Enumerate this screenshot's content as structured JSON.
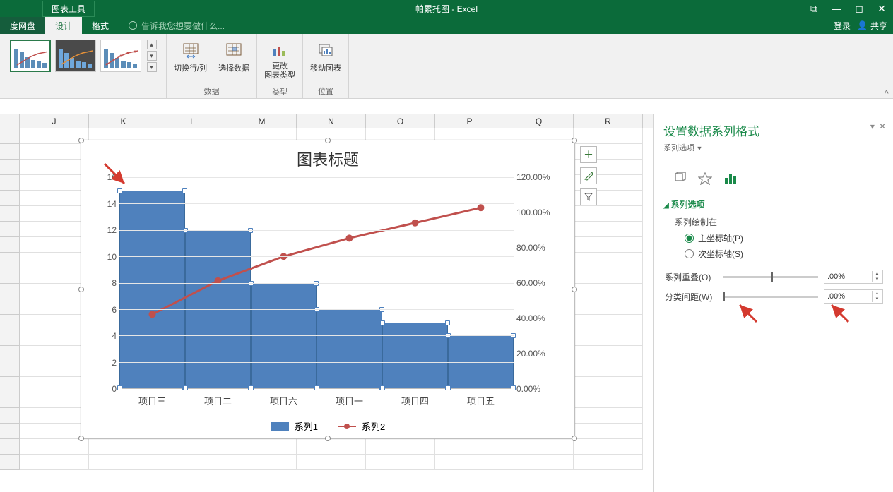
{
  "titlebar": {
    "tools_label": "图表工具",
    "doc_title": "帕累托图 - Excel"
  },
  "tabs": {
    "left": "度网盘",
    "design": "设计",
    "format": "格式",
    "tellme": "告诉我您想要做什么...",
    "login": "登录",
    "share": "共享"
  },
  "ribbon": {
    "data_group": "数据",
    "switch_rowcol": "切换行/列",
    "select_data": "选择数据",
    "type_group": "类型",
    "change_type": "更改\n图表类型",
    "location_group": "位置",
    "move_chart": "移动图表"
  },
  "columns": [
    "J",
    "K",
    "L",
    "M",
    "N",
    "O",
    "P",
    "Q",
    "R"
  ],
  "chart_data": {
    "type": "bar+line",
    "title": "图表标题",
    "categories": [
      "项目三",
      "项目二",
      "项目六",
      "项目一",
      "项目四",
      "项目五"
    ],
    "series": [
      {
        "name": "系列1",
        "values": [
          15,
          12,
          8,
          6,
          5,
          4
        ],
        "axis": "primary",
        "type": "bar",
        "color": "#4f81bd"
      },
      {
        "name": "系列2",
        "values": [
          30,
          52,
          68,
          80,
          90,
          100
        ],
        "axis": "secondary",
        "type": "line",
        "color": "#c0504d"
      }
    ],
    "y_primary": {
      "min": 0,
      "max": 16,
      "step": 2
    },
    "y_secondary": {
      "min": 0,
      "max": 120,
      "step": 20,
      "format": "percent"
    }
  },
  "pane": {
    "title": "设置数据系列格式",
    "subtitle": "系列选项",
    "section": "系列选项",
    "plot_on": "系列绘制在",
    "primary_axis": "主坐标轴(P)",
    "secondary_axis": "次坐标轴(S)",
    "overlap": "系列重叠(O)",
    "gap": "分类间距(W)",
    "overlap_val": ".00%",
    "gap_val": ".00%"
  }
}
